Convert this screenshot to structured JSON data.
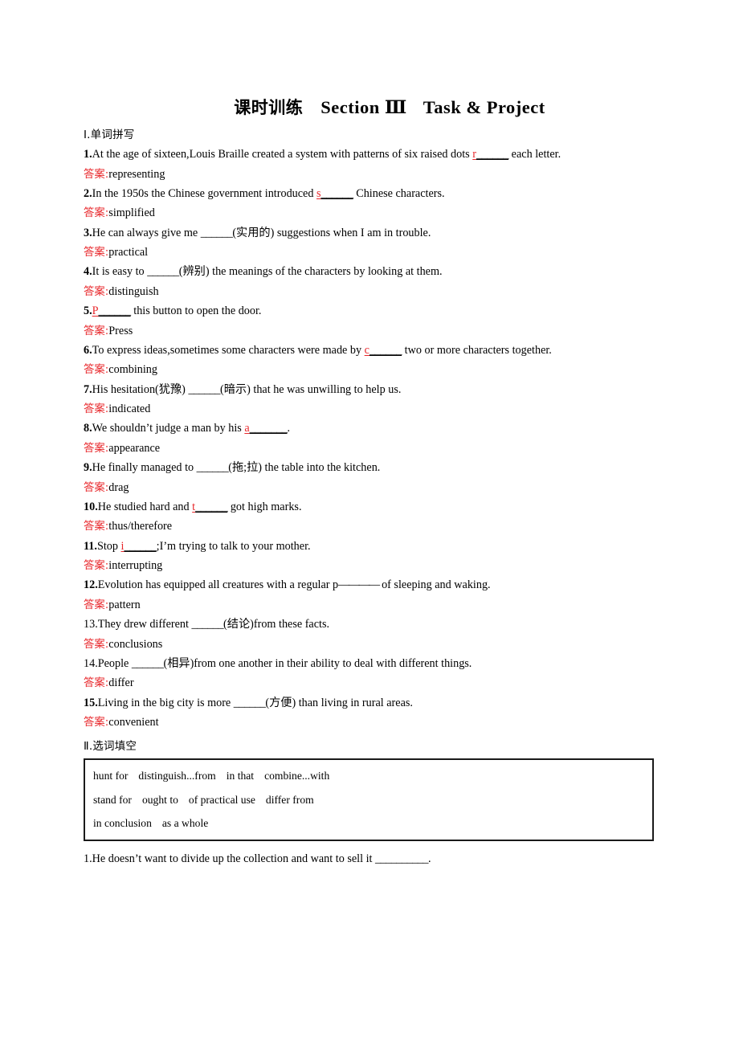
{
  "title": {
    "cn": "课时训练",
    "section": "Section Ⅲ",
    "task": "Task & Project"
  },
  "sections": [
    {
      "id": "I",
      "label": "Ⅰ.单词拼写"
    },
    {
      "id": "II",
      "label": "Ⅱ.选词填空"
    }
  ],
  "answer_label": "答案:",
  "spelling": {
    "items": [
      {
        "num": "1.",
        "num_bold": true,
        "pre": "At the age of sixteen,Louis Braille created a system with patterns of six raised dots ",
        "hint": "r",
        "hint_color": "red",
        "blank": "______",
        "blank_underlined": true,
        "post": " each letter.",
        "answer": "representing"
      },
      {
        "num": "2.",
        "num_bold": true,
        "pre": "In the 1950s the Chinese government introduced ",
        "hint": "s",
        "hint_color": "red",
        "blank": "______",
        "blank_underlined": true,
        "post": " Chinese characters.",
        "answer": "simplified"
      },
      {
        "num": "3.",
        "num_bold": true,
        "pre": "He can always give me ",
        "hint": "",
        "hint_color": "none",
        "blank": "______",
        "blank_underlined": false,
        "post": "(实用的) suggestions when I am in trouble.",
        "answer": "practical"
      },
      {
        "num": "4.",
        "num_bold": true,
        "pre": "It is easy to ",
        "hint": "",
        "hint_color": "none",
        "blank": "______",
        "blank_underlined": false,
        "post": "(辨别) the meanings of the characters by looking at them.",
        "answer": "distinguish"
      },
      {
        "num": "5.",
        "num_bold": true,
        "pre": "",
        "hint": "P",
        "hint_color": "red",
        "blank": "______",
        "blank_underlined": true,
        "post": " this button to open the door.",
        "answer": "Press"
      },
      {
        "num": "6.",
        "num_bold": true,
        "pre": "To express ideas,sometimes some characters were made by ",
        "hint": "c",
        "hint_color": "red",
        "blank": "______",
        "blank_underlined": true,
        "post": " two or more characters together.",
        "answer": "combining"
      },
      {
        "num": "7.",
        "num_bold": true,
        "pre": "His hesitation(犹豫) ",
        "hint": "",
        "hint_color": "none",
        "blank": "______",
        "blank_underlined": false,
        "post": "(暗示) that he was unwilling to help us.",
        "answer": "indicated"
      },
      {
        "num": "8.",
        "num_bold": true,
        "pre": "We shouldn’t judge a man by his ",
        "hint": "a",
        "hint_color": "red",
        "blank": "_______",
        "blank_underlined": true,
        "post": ".",
        "answer": "appearance"
      },
      {
        "num": "9.",
        "num_bold": true,
        "pre": "He finally managed to ",
        "hint": "",
        "hint_color": "none",
        "blank": "______",
        "blank_underlined": false,
        "post": "(拖;拉) the table into the kitchen.",
        "answer": "drag"
      },
      {
        "num": "10.",
        "num_bold": true,
        "pre": "He studied hard and ",
        "hint": "t",
        "hint_color": "red",
        "blank": "______",
        "blank_underlined": true,
        "post": " got high marks.",
        "answer": "thus/therefore"
      },
      {
        "num": "11.",
        "num_bold": true,
        "pre": "Stop ",
        "hint": "i",
        "hint_color": "red",
        "blank": "______",
        "blank_underlined": true,
        "post": ";I’m trying to talk to your mother.",
        "answer": "interrupting"
      },
      {
        "num": "12.",
        "num_bold": true,
        "pre": "Evolution has equipped all creatures with a regular p",
        "hint": "",
        "hint_color": "none",
        "blank": "————",
        "blank_underlined": false,
        "blank_dashes": true,
        "post": " of sleeping and waking.",
        "answer": "pattern"
      },
      {
        "num": "13.",
        "num_bold": false,
        "pre": "They drew different ",
        "hint": "",
        "hint_color": "none",
        "blank": "______",
        "blank_underlined": false,
        "post": "(结论)from these facts.",
        "answer": "conclusions"
      },
      {
        "num": "14.",
        "num_bold": false,
        "pre": "People ",
        "hint": "",
        "hint_color": "none",
        "blank": "______",
        "blank_underlined": false,
        "post": "(相异)from one another in their ability to deal with different things.",
        "answer": "differ"
      },
      {
        "num": "15.",
        "num_bold": true,
        "pre": "Living in the big city is more ",
        "hint": "",
        "hint_color": "none",
        "blank": "______",
        "blank_underlined": false,
        "post": "(方便) than living in rural areas.",
        "answer": "convenient"
      }
    ]
  },
  "wordbank": {
    "rows": [
      [
        "hunt for",
        "distinguish...from",
        "in that",
        "combine...with"
      ],
      [
        "stand for",
        "ought to",
        "of practical use",
        "differ from"
      ],
      [
        "in conclusion",
        "as a whole"
      ]
    ]
  },
  "cloze": {
    "items": [
      {
        "num": "1.",
        "pre": "He doesn’t want to divide up the collection and want to sell it ",
        "blank": "__________",
        "post": "."
      }
    ]
  }
}
